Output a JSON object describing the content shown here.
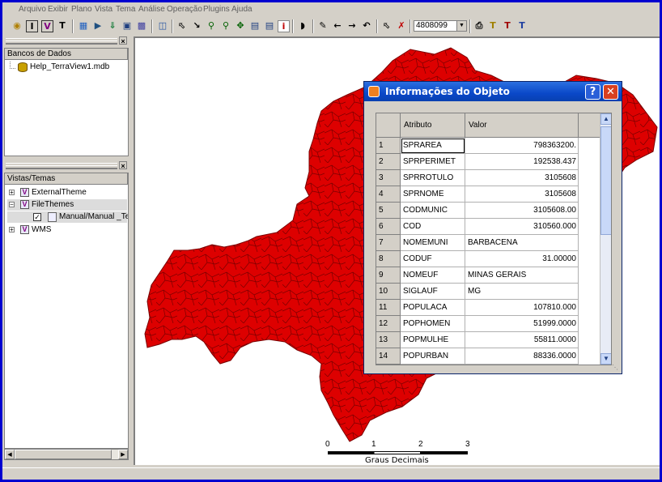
{
  "menu": [
    "Arquivo",
    "Exibir",
    "Plano",
    "Vista",
    "Tema",
    "Análise",
    "Operação",
    "Plugins",
    "Ajuda"
  ],
  "toolbar": {
    "zoom_value": "4808099",
    "icons": [
      "database-icon",
      "info-i-icon",
      "view-v-icon",
      "text-t-icon",
      "add-layer-icon",
      "query-icon",
      "export-icon",
      "display-icon",
      "grid-icon",
      "window-icon",
      "pointer-icon",
      "zoom-area-icon",
      "zoom-in-icon",
      "zoom-out-icon",
      "pan-icon",
      "fit-icon",
      "clear-icon",
      "info-icon",
      "shape-icon",
      "draw-line-icon",
      "back-arrow-icon",
      "forward-arrow-icon",
      "undo-icon",
      "select-icon",
      "delete-icon",
      "print-icon",
      "text-tool-icon",
      "tf-theme-icon",
      "tv-view-icon"
    ]
  },
  "databases_panel": {
    "header": "Bancos de Dados",
    "items": [
      "Help_TerraView1.mdb"
    ]
  },
  "views_panel": {
    "header": "Vistas/Temas",
    "items": [
      {
        "label": "ExternalTheme",
        "expander": "+"
      },
      {
        "label": "FileThemes",
        "expander": "−"
      },
      {
        "label": "Manual/Manual _TerraV",
        "expander": ""
      },
      {
        "label": "WMS",
        "expander": "+"
      }
    ]
  },
  "dialog": {
    "title": "Informações do Objeto",
    "help_label": "?",
    "close_label": "✕",
    "col_attr": "Atributo",
    "col_val": "Valor",
    "rows": [
      {
        "n": "1",
        "attr": "SPRAREA",
        "val": "798363200."
      },
      {
        "n": "2",
        "attr": "SPRPERIMET",
        "val": "192538.437"
      },
      {
        "n": "3",
        "attr": "SPRROTULO",
        "val": "3105608"
      },
      {
        "n": "4",
        "attr": "SPRNOME",
        "val": "3105608"
      },
      {
        "n": "5",
        "attr": "CODMUNIC",
        "val": "3105608.00"
      },
      {
        "n": "6",
        "attr": "COD",
        "val": "310560.000"
      },
      {
        "n": "7",
        "attr": "NOMEMUNI",
        "val": "BARBACENA"
      },
      {
        "n": "8",
        "attr": "CODUF",
        "val": "31.00000"
      },
      {
        "n": "9",
        "attr": "NOMEUF",
        "val": "MINAS GERAIS"
      },
      {
        "n": "10",
        "attr": "SIGLAUF",
        "val": "MG"
      },
      {
        "n": "11",
        "attr": "POPULACA",
        "val": "107810.000"
      },
      {
        "n": "12",
        "attr": "POPHOMEN",
        "val": "51999.0000"
      },
      {
        "n": "13",
        "attr": "POPMULHE",
        "val": "55811.0000"
      },
      {
        "n": "14",
        "attr": "POPURBAN",
        "val": "88336.0000"
      }
    ]
  },
  "scale_bar": {
    "ticks": [
      "0",
      "1",
      "2",
      "3"
    ],
    "unit": "Graus Decimais"
  },
  "colors": {
    "map_fill": "#dd0000",
    "map_border": "#7a0000",
    "title_bar": "#0a48c8",
    "frame": "#0000d0"
  }
}
